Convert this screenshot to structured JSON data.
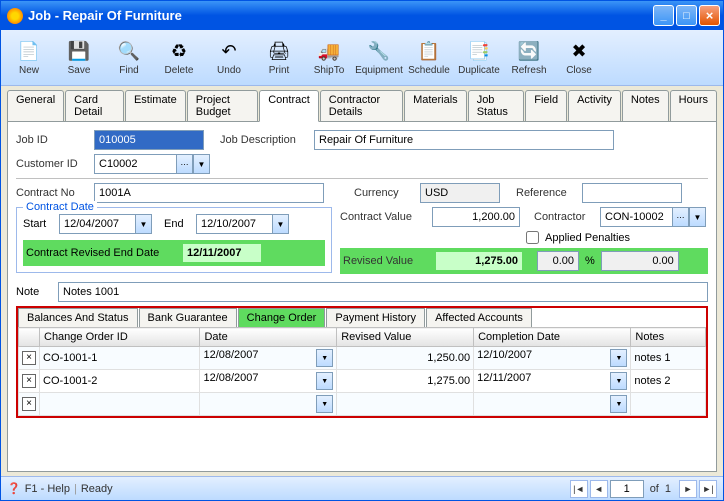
{
  "title": "Job - Repair Of Furniture",
  "toolbar": [
    {
      "label": "New",
      "icon": "📄"
    },
    {
      "label": "Save",
      "icon": "💾"
    },
    {
      "label": "Find",
      "icon": "🔍"
    },
    {
      "label": "Delete",
      "icon": "♻"
    },
    {
      "label": "Undo",
      "icon": "↶"
    },
    {
      "label": "Print",
      "icon": "🖨"
    },
    {
      "label": "ShipTo",
      "icon": "🚚"
    },
    {
      "label": "Equipment",
      "icon": "🔧"
    },
    {
      "label": "Schedule",
      "icon": "📋"
    },
    {
      "label": "Duplicate",
      "icon": "📑"
    },
    {
      "label": "Refresh",
      "icon": "🔄"
    },
    {
      "label": "Close",
      "icon": "✖"
    }
  ],
  "tabs": [
    "General",
    "Card Detail",
    "Estimate",
    "Project Budget",
    "Contract",
    "Contractor Details",
    "Materials",
    "Job Status",
    "Field",
    "Activity",
    "Notes",
    "Hours"
  ],
  "active_tab": "Contract",
  "form": {
    "job_id_lbl": "Job ID",
    "job_id": "010005",
    "job_desc_lbl": "Job Description",
    "job_desc": "Repair Of Furniture",
    "cust_id_lbl": "Customer ID",
    "cust_id": "C10002",
    "contract_no_lbl": "Contract No",
    "contract_no": "1001A",
    "currency_lbl": "Currency",
    "currency": "USD",
    "reference_lbl": "Reference",
    "reference": "",
    "contract_date_lbl": "Contract Date",
    "start_lbl": "Start",
    "start": "12/04/2007",
    "end_lbl": "End",
    "end": "12/10/2007",
    "contract_value_lbl": "Contract Value",
    "contract_value": "1,200.00",
    "contractor_lbl": "Contractor",
    "contractor": "CON-10002",
    "revised_end_lbl": "Contract Revised End Date",
    "revised_end": "12/11/2007",
    "revised_value_lbl": "Revised Value",
    "revised_value": "1,275.00",
    "penalties_lbl": "Applied Penalties",
    "penalties_checked": false,
    "penalty_pct": "0.00",
    "penalty_amt": "0.00",
    "note_lbl": "Note",
    "note": "Notes 1001"
  },
  "subtabs": [
    "Balances And Status",
    "Bank Guarantee",
    "Change Order",
    "Payment History",
    "Affected Accounts"
  ],
  "active_subtab": "Change Order",
  "grid": {
    "headers": [
      "Change Order ID",
      "Date",
      "Revised Value",
      "Completion Date",
      "Notes"
    ],
    "rows": [
      {
        "id": "CO-1001-1",
        "date": "12/08/2007",
        "value": "1,250.00",
        "comp": "12/10/2007",
        "notes": "notes 1"
      },
      {
        "id": "CO-1001-2",
        "date": "12/08/2007",
        "value": "1,275.00",
        "comp": "12/11/2007",
        "notes": "notes 2"
      },
      {
        "id": "",
        "date": "",
        "value": "",
        "comp": "",
        "notes": ""
      }
    ]
  },
  "status": {
    "help": "F1 - Help",
    "ready": "Ready",
    "page": "1",
    "of_lbl": "of",
    "total": "1"
  }
}
